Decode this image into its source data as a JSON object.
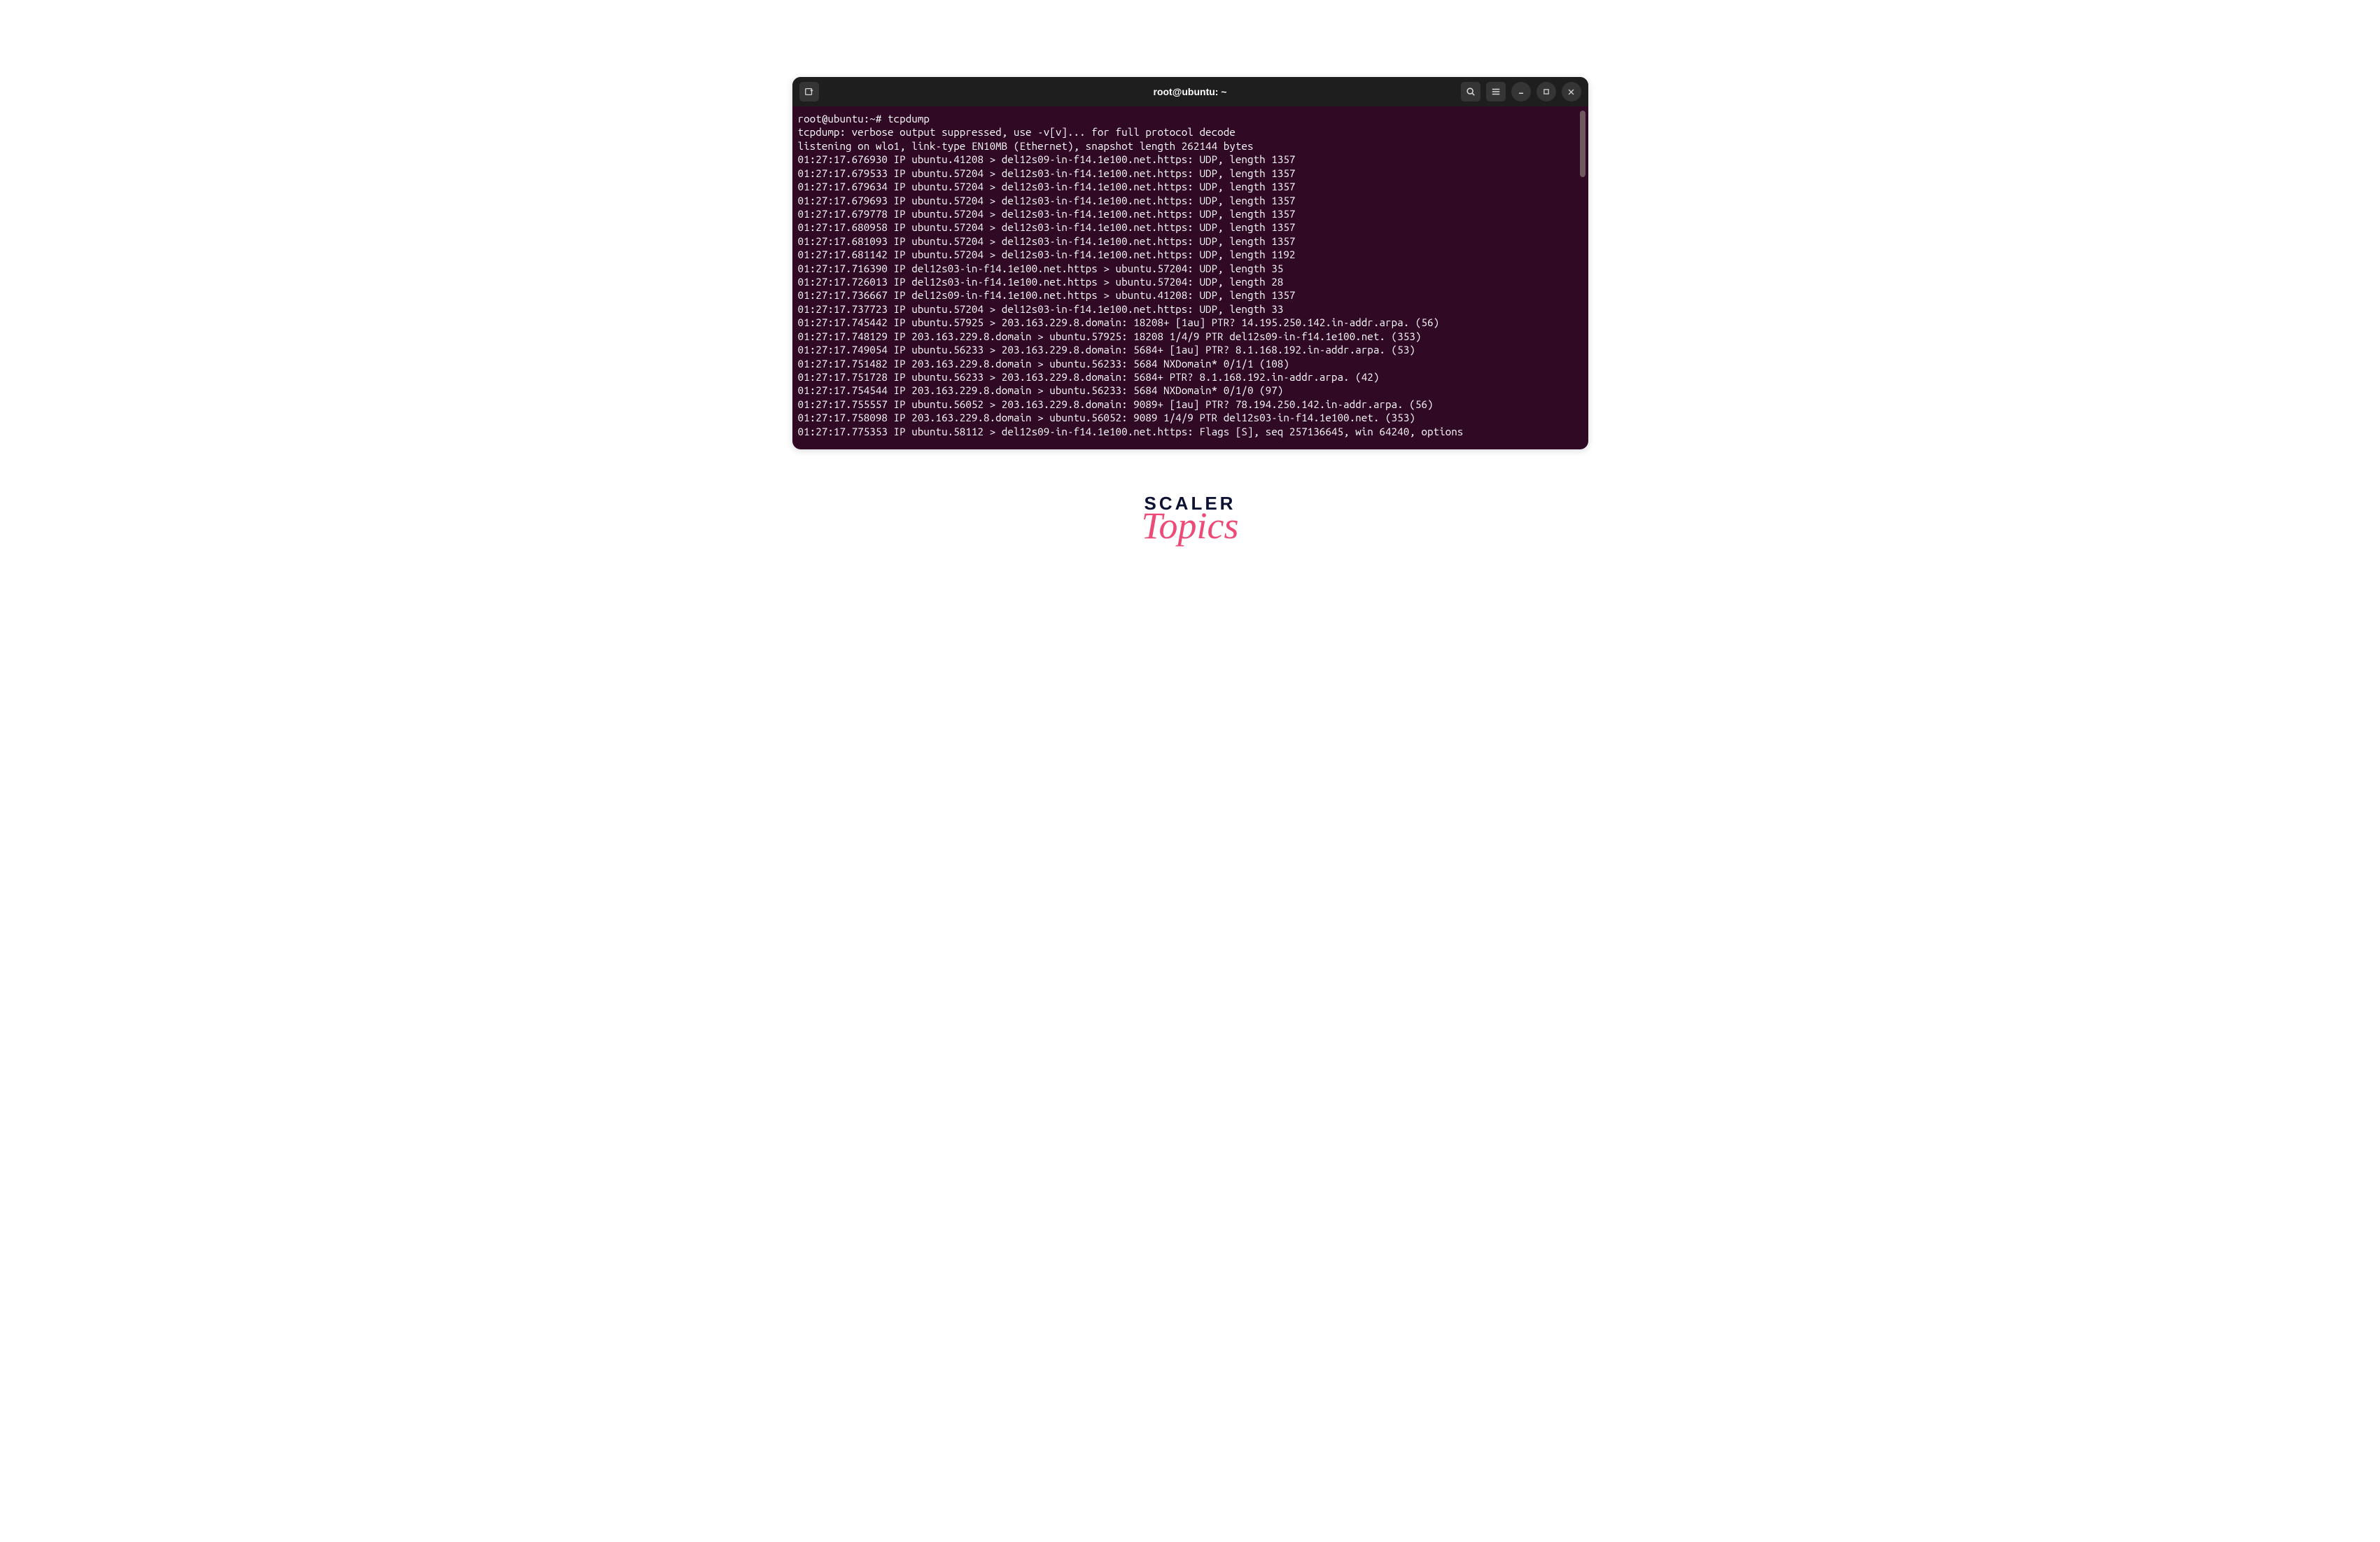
{
  "titlebar": {
    "title": "root@ubuntu: ~"
  },
  "terminal": {
    "prompt": "root@ubuntu:~# tcpdump",
    "lines": [
      "tcpdump: verbose output suppressed, use -v[v]... for full protocol decode",
      "listening on wlo1, link-type EN10MB (Ethernet), snapshot length 262144 bytes",
      "01:27:17.676930 IP ubuntu.41208 > del12s09-in-f14.1e100.net.https: UDP, length 1357",
      "01:27:17.679533 IP ubuntu.57204 > del12s03-in-f14.1e100.net.https: UDP, length 1357",
      "01:27:17.679634 IP ubuntu.57204 > del12s03-in-f14.1e100.net.https: UDP, length 1357",
      "01:27:17.679693 IP ubuntu.57204 > del12s03-in-f14.1e100.net.https: UDP, length 1357",
      "01:27:17.679778 IP ubuntu.57204 > del12s03-in-f14.1e100.net.https: UDP, length 1357",
      "01:27:17.680958 IP ubuntu.57204 > del12s03-in-f14.1e100.net.https: UDP, length 1357",
      "01:27:17.681093 IP ubuntu.57204 > del12s03-in-f14.1e100.net.https: UDP, length 1357",
      "01:27:17.681142 IP ubuntu.57204 > del12s03-in-f14.1e100.net.https: UDP, length 1192",
      "01:27:17.716390 IP del12s03-in-f14.1e100.net.https > ubuntu.57204: UDP, length 35",
      "01:27:17.726013 IP del12s03-in-f14.1e100.net.https > ubuntu.57204: UDP, length 28",
      "01:27:17.736667 IP del12s09-in-f14.1e100.net.https > ubuntu.41208: UDP, length 1357",
      "01:27:17.737723 IP ubuntu.57204 > del12s03-in-f14.1e100.net.https: UDP, length 33",
      "01:27:17.745442 IP ubuntu.57925 > 203.163.229.8.domain: 18208+ [1au] PTR? 14.195.250.142.in-addr.arpa. (56)",
      "01:27:17.748129 IP 203.163.229.8.domain > ubuntu.57925: 18208 1/4/9 PTR del12s09-in-f14.1e100.net. (353)",
      "01:27:17.749054 IP ubuntu.56233 > 203.163.229.8.domain: 5684+ [1au] PTR? 8.1.168.192.in-addr.arpa. (53)",
      "01:27:17.751482 IP 203.163.229.8.domain > ubuntu.56233: 5684 NXDomain* 0/1/1 (108)",
      "01:27:17.751728 IP ubuntu.56233 > 203.163.229.8.domain: 5684+ PTR? 8.1.168.192.in-addr.arpa. (42)",
      "01:27:17.754544 IP 203.163.229.8.domain > ubuntu.56233: 5684 NXDomain* 0/1/0 (97)",
      "01:27:17.755557 IP ubuntu.56052 > 203.163.229.8.domain: 9089+ [1au] PTR? 78.194.250.142.in-addr.arpa. (56)",
      "01:27:17.758098 IP 203.163.229.8.domain > ubuntu.56052: 9089 1/4/9 PTR del12s03-in-f14.1e100.net. (353)",
      "01:27:17.775353 IP ubuntu.58112 > del12s09-in-f14.1e100.net.https: Flags [S], seq 257136645, win 64240, options "
    ]
  },
  "branding": {
    "line1": "SCALER",
    "line2": "Topics"
  },
  "icons": {
    "newtab": "new-tab",
    "search": "search",
    "menu": "menu",
    "minimize": "minimize",
    "maximize": "maximize",
    "close": "close"
  }
}
